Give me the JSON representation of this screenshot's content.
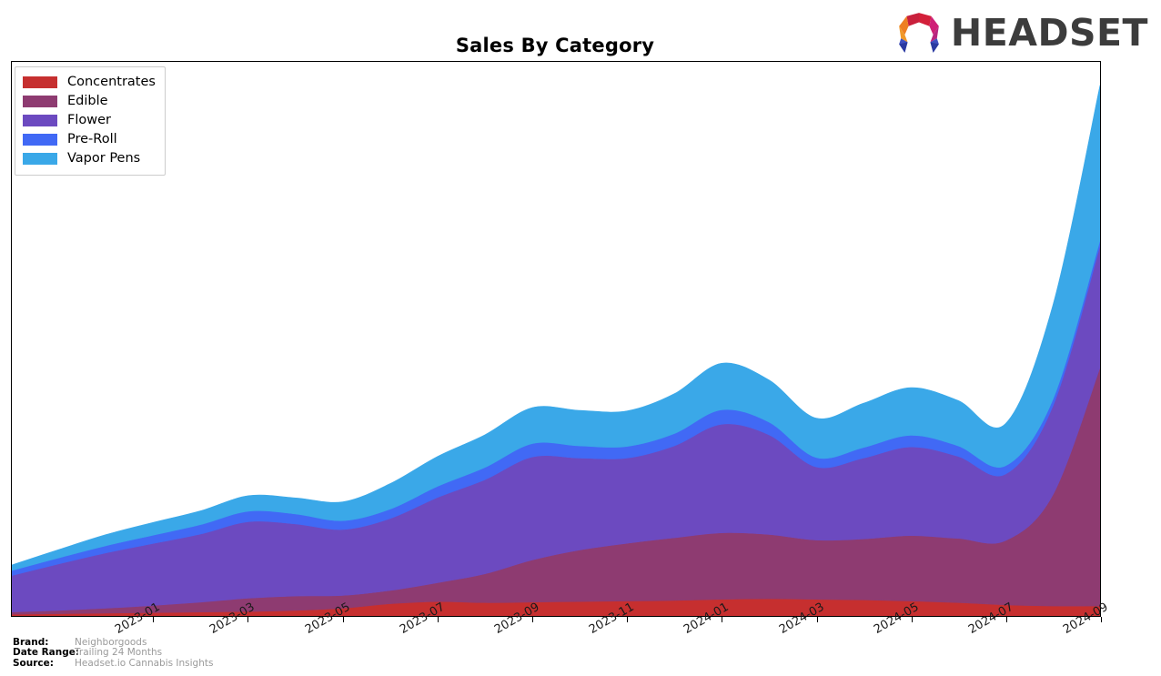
{
  "header": {
    "title": "Sales By Category",
    "logo_word": "HEADSET",
    "logo_icon": "headset-hexagon-icon"
  },
  "legend": {
    "position": "top-left",
    "items": [
      {
        "label": "Concentrates",
        "color": "#c62f2f"
      },
      {
        "label": "Edible",
        "color": "#8e3b71"
      },
      {
        "label": "Flower",
        "color": "#6c4ac0"
      },
      {
        "label": "Pre-Roll",
        "color": "#4169f5"
      },
      {
        "label": "Vapor Pens",
        "color": "#3aa8e8"
      }
    ]
  },
  "footer": {
    "rows": [
      {
        "key": "Brand:",
        "value": "Neighborgoods"
      },
      {
        "key": "Date Range:",
        "value": "Trailing 24 Months"
      },
      {
        "key": "Source:",
        "value": "Headset.io Cannabis Insights"
      }
    ]
  },
  "chart_data": {
    "type": "area",
    "stacked": true,
    "title": "Sales By Category",
    "xlabel": "",
    "ylabel": "",
    "grid": false,
    "legend_position": "upper left",
    "x_tick_labels": [
      "2023-01",
      "2023-03",
      "2023-05",
      "2023-07",
      "2023-09",
      "2023-11",
      "2024-01",
      "2024-03",
      "2024-05",
      "2024-07",
      "2024-09"
    ],
    "x": [
      "2022-10",
      "2022-11",
      "2022-12",
      "2023-01",
      "2023-02",
      "2023-03",
      "2023-04",
      "2023-05",
      "2023-06",
      "2023-07",
      "2023-08",
      "2023-09",
      "2023-10",
      "2023-11",
      "2023-12",
      "2024-01",
      "2024-02",
      "2024-03",
      "2024-04",
      "2024-05",
      "2024-06",
      "2024-07",
      "2024-08",
      "2024-09"
    ],
    "ylim": [
      0,
      100
    ],
    "y_units": "percent-of-max-total",
    "series": [
      {
        "name": "Concentrates",
        "color": "#c62f2f",
        "values": [
          0.3,
          0.4,
          0.5,
          0.6,
          0.7,
          0.8,
          1.0,
          1.4,
          2.2,
          2.6,
          2.4,
          2.5,
          2.6,
          2.7,
          2.8,
          3.0,
          3.1,
          3.0,
          2.9,
          2.7,
          2.4,
          2.0,
          1.8,
          1.8
        ]
      },
      {
        "name": "Edible",
        "color": "#8e3b71",
        "values": [
          0.4,
          0.6,
          0.9,
          1.3,
          1.8,
          2.4,
          2.6,
          2.3,
          2.4,
          3.4,
          5.2,
          7.6,
          9.3,
          10.4,
          11.3,
          12.0,
          11.6,
          10.7,
          11.0,
          11.8,
          11.6,
          11.6,
          20.0,
          43.0
        ]
      },
      {
        "name": "Flower",
        "color": "#6c4ac0",
        "values": [
          6.6,
          8.4,
          10.0,
          11.2,
          12.3,
          13.8,
          13.0,
          11.9,
          13.0,
          15.4,
          17.0,
          18.6,
          16.6,
          15.4,
          16.6,
          19.6,
          18.0,
          13.2,
          14.6,
          16.0,
          14.8,
          12.0,
          16.0,
          22.0
        ]
      },
      {
        "name": "Pre-Roll",
        "color": "#4169f5",
        "values": [
          0.9,
          1.1,
          1.3,
          1.5,
          1.7,
          1.9,
          1.8,
          1.6,
          1.7,
          2.0,
          2.2,
          2.4,
          2.2,
          2.1,
          2.2,
          2.6,
          2.3,
          1.7,
          1.9,
          2.1,
          1.9,
          1.5,
          1.2,
          1.0
        ]
      },
      {
        "name": "Vapor Pens",
        "color": "#3aa8e8",
        "values": [
          1.0,
          1.5,
          2.0,
          2.3,
          2.5,
          2.8,
          2.9,
          3.4,
          4.6,
          5.4,
          5.9,
          6.5,
          6.4,
          6.4,
          7.2,
          8.4,
          7.6,
          7.1,
          8.0,
          8.6,
          8.2,
          7.6,
          17.0,
          28.0
        ]
      }
    ]
  }
}
